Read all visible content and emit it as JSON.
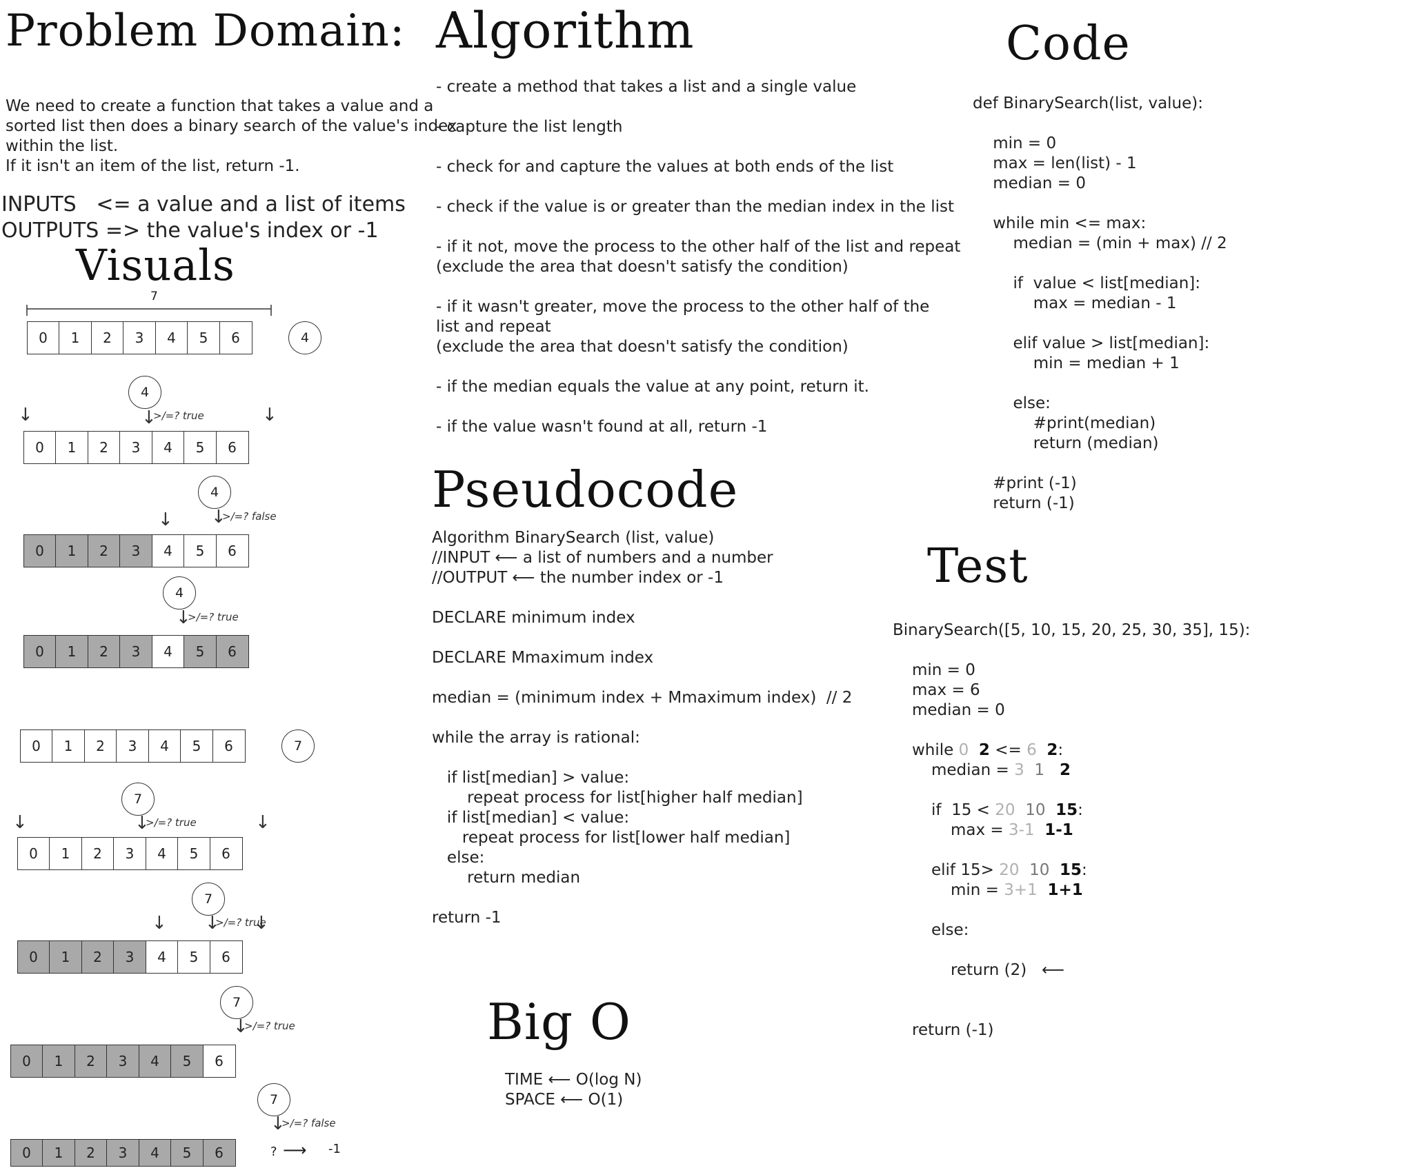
{
  "problem_domain": {
    "title": "Problem Domain:",
    "description": [
      "We need to create a function that takes a value and a",
      "sorted list then does a binary search of the value's index",
      "within the list.",
      "If it isn't an item of the list, return -1."
    ],
    "inputs": "INPUTS   <= a value and a list of items",
    "outputs": "OUTPUTS => the value's index or -1"
  },
  "visuals": {
    "title": "Visuals",
    "length_label": "7",
    "cells": [
      "0",
      "1",
      "2",
      "3",
      "4",
      "5",
      "6"
    ],
    "example1_value": "4",
    "example2_value": "7",
    "compare_true": ">/=?  true",
    "compare_false": ">/=?  false",
    "result_question": "?",
    "result_value": "-1"
  },
  "algorithm": {
    "title": "Algorithm",
    "steps": [
      "- create a method that takes a list and a single value",
      "- capture the list length",
      "- check for and capture the values at both ends of the list",
      "- check if the value is or greater than the median index in the list",
      "- if it not, move the process to the other half of the list and repeat",
      "(exclude the area that doesn't satisfy the condition)",
      "- if it wasn't greater, move the process to the other half of the",
      "list and repeat",
      "(exclude the area that doesn't satisfy the condition)",
      "- if the median equals the value at any point, return it.",
      "- if the value wasn't found at all, return -1"
    ]
  },
  "pseudocode": {
    "title": "Pseudocode",
    "lines": [
      "Algorithm BinarySearch (list, value)",
      "//INPUT ⟵ a list of numbers and a number",
      "//OUTPUT ⟵ the number index or -1",
      "",
      "DECLARE minimum index",
      "",
      "DECLARE Mmaximum index",
      "",
      "median = (minimum index + Mmaximum index)  // 2",
      "",
      "while the array is rational:",
      "",
      "   if list[median] > value:",
      "       repeat process for list[higher half median]",
      "   if list[median] < value:",
      "      repeat process for list[lower half median]",
      "   else:",
      "       return median",
      "",
      "return -1"
    ]
  },
  "big_o": {
    "title": "Big O",
    "time": "TIME ⟵ O(log N)",
    "space": "SPACE ⟵ O(1)"
  },
  "code": {
    "title": "Code",
    "lines": [
      "def BinarySearch(list, value):",
      "",
      "    min = 0",
      "    max = len(list) - 1",
      "    median = 0",
      "",
      "    while min <= max:",
      "        median = (min + max) // 2",
      "",
      "        if  value < list[median]:",
      "            max = median - 1",
      "",
      "        elif value > list[median]:",
      "            min = median + 1",
      "",
      "        else:",
      "            #print(median)",
      "            return (median)",
      "",
      "    #print (-1)",
      "    return (-1)"
    ]
  },
  "test": {
    "title": "Test",
    "call": "BinarySearch([5, 10, 15, 20, 25, 30, 35], 15):",
    "min_line": "min = 0",
    "max_line": "max = 6",
    "median_line": "median = 0",
    "while_prefix": "while ",
    "while_v1": "0",
    "while_v2": "2",
    "while_mid": " <= ",
    "while_v3": "6",
    "while_v4": "2",
    "while_suffix": ":",
    "median_prefix": "median = ",
    "median_v1": "3",
    "median_v2": "1",
    "median_v3": "2",
    "if_prefix": "if  15 < ",
    "if_v1": "20",
    "if_v2": "10",
    "if_v3": "15",
    "if_suffix": ":",
    "max_prefix": "max = ",
    "max_v1": "3-1",
    "max_v2": "1-1",
    "elif_prefix": "elif 15> ",
    "elif_v1": "20",
    "elif_v2": "10",
    "elif_v3": "15",
    "elif_suffix": ":",
    "min_prefix": "min = ",
    "min_v1": "3+1",
    "min_v2": "1+1",
    "else_line": "else:",
    "return_line": "return (2)",
    "return_arrow": "⟵",
    "final_return": "return (-1)"
  }
}
